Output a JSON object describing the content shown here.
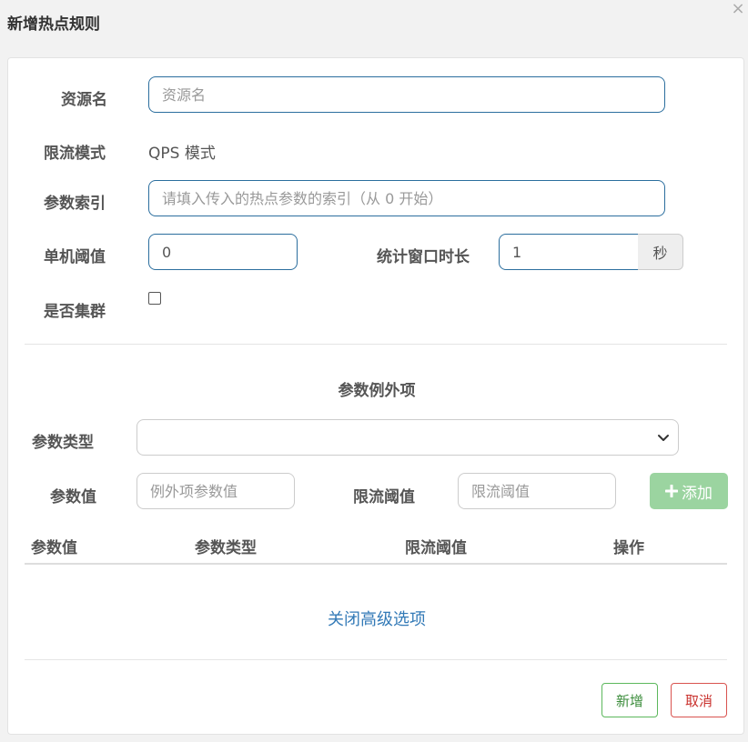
{
  "dialog": {
    "title": "新增热点规则",
    "close": "×"
  },
  "form": {
    "resource": {
      "label": "资源名",
      "placeholder": "资源名",
      "value": ""
    },
    "mode": {
      "label": "限流模式",
      "value": "QPS 模式"
    },
    "param_index": {
      "label": "参数索引",
      "placeholder": "请填入传入的热点参数的索引（从 0 开始）",
      "value": ""
    },
    "threshold": {
      "label": "单机阈值",
      "value": "0"
    },
    "window": {
      "label": "统计窗口时长",
      "value": "1",
      "unit": "秒"
    },
    "cluster": {
      "label": "是否集群",
      "checked": false
    }
  },
  "exceptions": {
    "title": "参数例外项",
    "type_label": "参数类型",
    "type_value": "",
    "value_label": "参数值",
    "value_placeholder": "例外项参数值",
    "limit_label": "限流阈值",
    "limit_placeholder": "限流阈值",
    "add_button": "添加",
    "columns": [
      "参数值",
      "参数类型",
      "限流阈值",
      "操作"
    ],
    "rows": []
  },
  "advanced_link": "关闭高级选项",
  "footer": {
    "ok_button": "新增",
    "cancel_button": "取消"
  },
  "colors": {
    "input_border": "#2b6e9e",
    "add_button": "#9bd4a0",
    "ok_border": "#5cb85c",
    "cancel_border": "#d9534f",
    "link": "#337ab7"
  }
}
